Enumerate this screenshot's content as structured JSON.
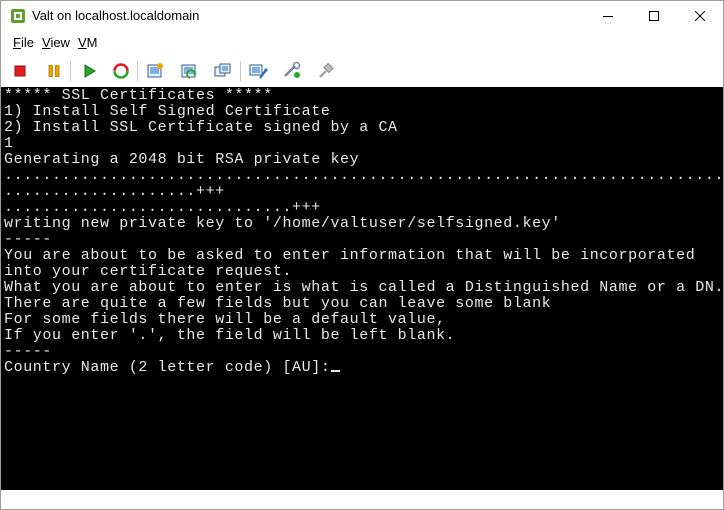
{
  "window": {
    "title": "Valt on localhost.localdomain",
    "minimize_glyph": "—",
    "maximize_glyph": "☐",
    "close_glyph": "✕"
  },
  "menubar": {
    "file_accel": "F",
    "file_rest": "ile",
    "view_accel": "V",
    "view_rest": "iew",
    "vm_accel": "V",
    "vm_rest": "M"
  },
  "toolbar": {
    "icons": [
      "stop-icon",
      "pause-icon",
      "play-icon",
      "reset-icon",
      "snapshot-take-icon",
      "snapshot-revert-icon",
      "snapshot-manager-icon",
      "vm-settings-icon",
      "install-tools-icon",
      "disconnect-icon"
    ]
  },
  "console": {
    "lines": [
      "***** SSL Certificates *****",
      "1) Install Self Signed Certificate",
      "2) Install SSL Certificate signed by a CA",
      "1",
      "Generating a 2048 bit RSA private key",
      "..................................................................................",
      "....................+++",
      "..............................+++",
      "writing new private key to '/home/valtuser/selfsigned.key'",
      "-----",
      "You are about to be asked to enter information that will be incorporated",
      "into your certificate request.",
      "What you are about to enter is what is called a Distinguished Name or a DN.",
      "There are quite a few fields but you can leave some blank",
      "For some fields there will be a default value,",
      "If you enter '.', the field will be left blank.",
      "-----",
      "Country Name (2 letter code) [AU]:"
    ]
  },
  "colors": {
    "console_bg": "#000000",
    "console_fg": "#e8e8e8",
    "stop": "#e01e1e",
    "pause": "#f2a500",
    "play": "#2aa52a"
  }
}
